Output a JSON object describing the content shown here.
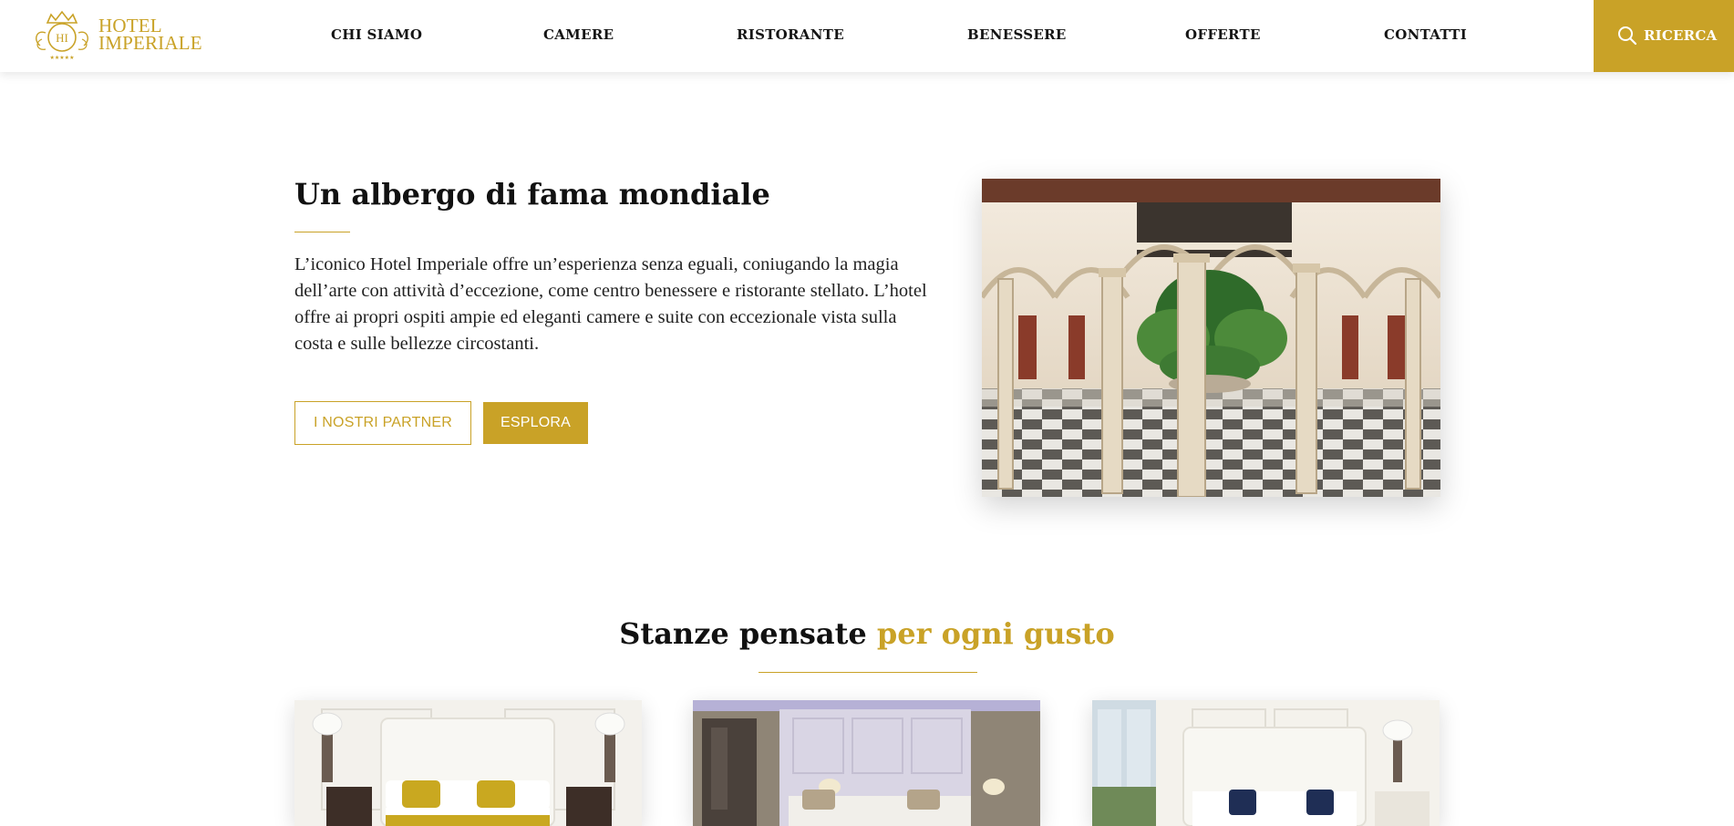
{
  "brand": {
    "line1": "HOTEL",
    "line2": "IMPERIALE",
    "emblem": "HI"
  },
  "nav": {
    "items": [
      {
        "label": "CHI SIAMO"
      },
      {
        "label": "CAMERE"
      },
      {
        "label": "RISTORANTE"
      },
      {
        "label": "BENESSERE"
      },
      {
        "label": "OFFERTE"
      },
      {
        "label": "CONTATTI"
      }
    ],
    "search_label": "RICERCA",
    "search_icon": "search-icon"
  },
  "intro": {
    "title": "Un albergo di fama mondiale",
    "text": "L’iconico Hotel Imperiale offre un’esperienza senza eguali, coniugando la magia dell’arte con attività d’eccezione, come centro benessere e ristorante stellato. L’hotel offre ai propri ospiti ampie ed eleganti camere e suite con eccezionale vista sulla costa e sulle bellezze circostanti.",
    "partner_button": "I NOSTRI PARTNER",
    "explore_button": "ESPLORA"
  },
  "rooms": {
    "title_main": "Stanze pensate ",
    "title_accent": "per ogni gusto"
  },
  "colors": {
    "accent": "#c9a227",
    "text": "#111111",
    "background": "#ffffff"
  }
}
